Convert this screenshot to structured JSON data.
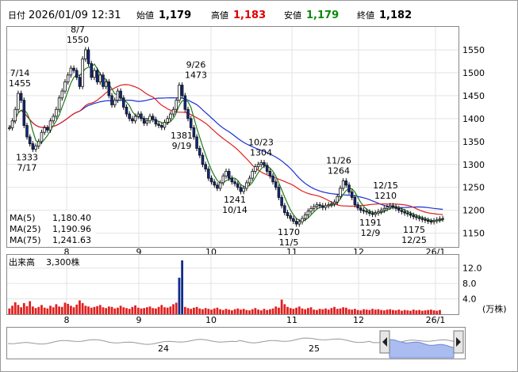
{
  "header": {
    "date_label": "日付",
    "date_value": "2026/01/09 12:31",
    "open_label": "始値",
    "open_value": "1,179",
    "high_label": "高値",
    "high_value": "1,183",
    "low_label": "安値",
    "low_value": "1,179",
    "close_label": "終値",
    "close_value": "1,182"
  },
  "colors": {
    "up": "#ffffff",
    "down": "#102a8a",
    "ma5": "#1f7a1f",
    "ma25": "#e02020",
    "ma75": "#1a2fd6",
    "high": "#e00000",
    "low": "#0a8a0a",
    "volume": "#e02020",
    "volume_high": "#102a8a",
    "navigator_fill": "#aabcf0"
  },
  "legend": [
    {
      "label": "MA(5)",
      "value": "1,180.40"
    },
    {
      "label": "MA(25)",
      "value": "1,190.96"
    },
    {
      "label": "MA(75)",
      "value": "1,241.63"
    }
  ],
  "volume_label": "出来高",
  "volume_value": "3,300株",
  "volume_unit": "(万株)",
  "navigator_labels": [
    "24",
    "25"
  ],
  "chart_data": [
    {
      "type": "candlestick",
      "title": "",
      "x_tick_labels": [
        "8",
        "9",
        "10",
        "11",
        "12",
        "26/1"
      ],
      "y_ticks": [
        1150,
        1200,
        1250,
        1300,
        1350,
        1400,
        1450,
        1500,
        1550
      ],
      "ylim": [
        1120,
        1600
      ],
      "grid": true,
      "annotations": [
        {
          "date": "7/14",
          "value": 1455,
          "label_top": "7/14",
          "label_bottom": "1455"
        },
        {
          "date": "7/17",
          "value": 1333,
          "label_top": "1333",
          "label_bottom": "7/17"
        },
        {
          "date": "8/7",
          "value": 1550,
          "label_top": "8/7",
          "label_bottom": "1550"
        },
        {
          "date": "9/19",
          "value": 1381,
          "label_top": "1381",
          "label_bottom": "9/19"
        },
        {
          "date": "9/26",
          "value": 1473,
          "label_top": "9/26",
          "label_bottom": "1473"
        },
        {
          "date": "10/14",
          "value": 1241,
          "label_top": "1241",
          "label_bottom": "10/14"
        },
        {
          "date": "10/23",
          "value": 1304,
          "label_top": "10/23",
          "label_bottom": "1304"
        },
        {
          "date": "11/5",
          "value": 1170,
          "label_top": "1170",
          "label_bottom": "11/5"
        },
        {
          "date": "11/26",
          "value": 1264,
          "label_top": "11/26",
          "label_bottom": "1264"
        },
        {
          "date": "12/9",
          "value": 1191,
          "label_top": "1191",
          "label_bottom": "12/9"
        },
        {
          "date": "12/15",
          "value": 1210,
          "label_top": "12/15",
          "label_bottom": "1210"
        },
        {
          "date": "12/25",
          "value": 1175,
          "label_top": "1175",
          "label_bottom": "12/25"
        }
      ],
      "candles_close": [
        1380,
        1395,
        1420,
        1455,
        1440,
        1385,
        1360,
        1345,
        1333,
        1340,
        1350,
        1370,
        1380,
        1375,
        1395,
        1405,
        1420,
        1445,
        1460,
        1480,
        1495,
        1510,
        1505,
        1490,
        1470,
        1530,
        1550,
        1520,
        1490,
        1505,
        1480,
        1495,
        1470,
        1480,
        1450,
        1430,
        1440,
        1460,
        1445,
        1425,
        1410,
        1400,
        1395,
        1405,
        1410,
        1400,
        1390,
        1395,
        1405,
        1398,
        1388,
        1385,
        1381,
        1392,
        1400,
        1410,
        1420,
        1440,
        1473,
        1450,
        1420,
        1400,
        1380,
        1360,
        1335,
        1320,
        1300,
        1290,
        1270,
        1262,
        1255,
        1248,
        1260,
        1275,
        1285,
        1270,
        1262,
        1258,
        1250,
        1241,
        1248,
        1260,
        1270,
        1285,
        1295,
        1300,
        1304,
        1298,
        1285,
        1275,
        1262,
        1250,
        1228,
        1210,
        1195,
        1188,
        1182,
        1176,
        1170,
        1175,
        1182,
        1190,
        1198,
        1204,
        1208,
        1212,
        1210,
        1206,
        1210,
        1212,
        1214,
        1218,
        1230,
        1248,
        1264,
        1255,
        1240,
        1228,
        1212,
        1205,
        1200,
        1198,
        1196,
        1193,
        1191,
        1194,
        1197,
        1200,
        1204,
        1207,
        1210,
        1208,
        1204,
        1200,
        1197,
        1194,
        1192,
        1189,
        1186,
        1184,
        1182,
        1180,
        1178,
        1176,
        1175,
        1177,
        1179,
        1181,
        1182
      ],
      "series": [
        {
          "name": "MA(5)",
          "last": 1180.4
        },
        {
          "name": "MA(25)",
          "last": 1190.96
        },
        {
          "name": "MA(75)",
          "last": 1241.63
        }
      ]
    },
    {
      "type": "bar",
      "title": "出来高",
      "x_tick_labels": [
        "8",
        "9",
        "10",
        "11",
        "12",
        "26/1"
      ],
      "y_ticks": [
        4.0,
        8.0,
        12.0
      ],
      "ylabel": "(万株)",
      "ylim": [
        0,
        14
      ],
      "values": [
        1.5,
        2.2,
        3.1,
        2.4,
        1.8,
        2.9,
        2.1,
        3.4,
        2.0,
        1.6,
        1.9,
        2.4,
        1.7,
        1.5,
        2.2,
        1.8,
        2.6,
        2.0,
        1.9,
        3.0,
        2.7,
        2.2,
        1.8,
        2.5,
        3.6,
        2.9,
        2.2,
        2.0,
        1.7,
        1.9,
        2.1,
        2.4,
        1.8,
        1.6,
        2.0,
        1.9,
        1.5,
        1.7,
        2.2,
        1.8,
        1.6,
        1.4,
        1.9,
        2.3,
        1.7,
        1.5,
        1.6,
        1.8,
        2.0,
        1.6,
        1.5,
        1.9,
        2.4,
        1.8,
        1.7,
        2.0,
        2.6,
        3.0,
        9.5,
        14.0,
        1.9,
        1.6,
        1.4,
        1.7,
        1.9,
        1.5,
        1.3,
        1.6,
        1.4,
        1.2,
        1.5,
        1.7,
        1.3,
        1.1,
        1.4,
        1.2,
        1.0,
        1.3,
        1.5,
        1.2,
        1.4,
        1.1,
        1.0,
        1.3,
        1.6,
        1.2,
        1.0,
        1.4,
        1.1,
        1.3,
        1.5,
        2.0,
        1.7,
        3.8,
        2.6,
        1.9,
        1.6,
        1.4,
        1.7,
        2.0,
        1.5,
        1.3,
        1.6,
        1.8,
        1.2,
        1.1,
        1.4,
        1.3,
        1.5,
        1.2,
        1.6,
        1.9,
        1.4,
        1.5,
        1.8,
        1.7,
        1.3,
        1.2,
        1.4,
        1.1,
        1.0,
        1.3,
        1.2,
        1.1,
        1.4,
        1.2,
        1.3,
        1.1,
        1.0,
        1.2,
        1.3,
        1.1,
        1.0,
        1.2,
        0.9,
        1.1,
        1.0,
        0.9,
        1.2,
        1.0,
        1.1,
        0.9,
        1.0,
        1.1,
        1.2,
        1.0,
        0.9,
        1.1
      ]
    }
  ]
}
